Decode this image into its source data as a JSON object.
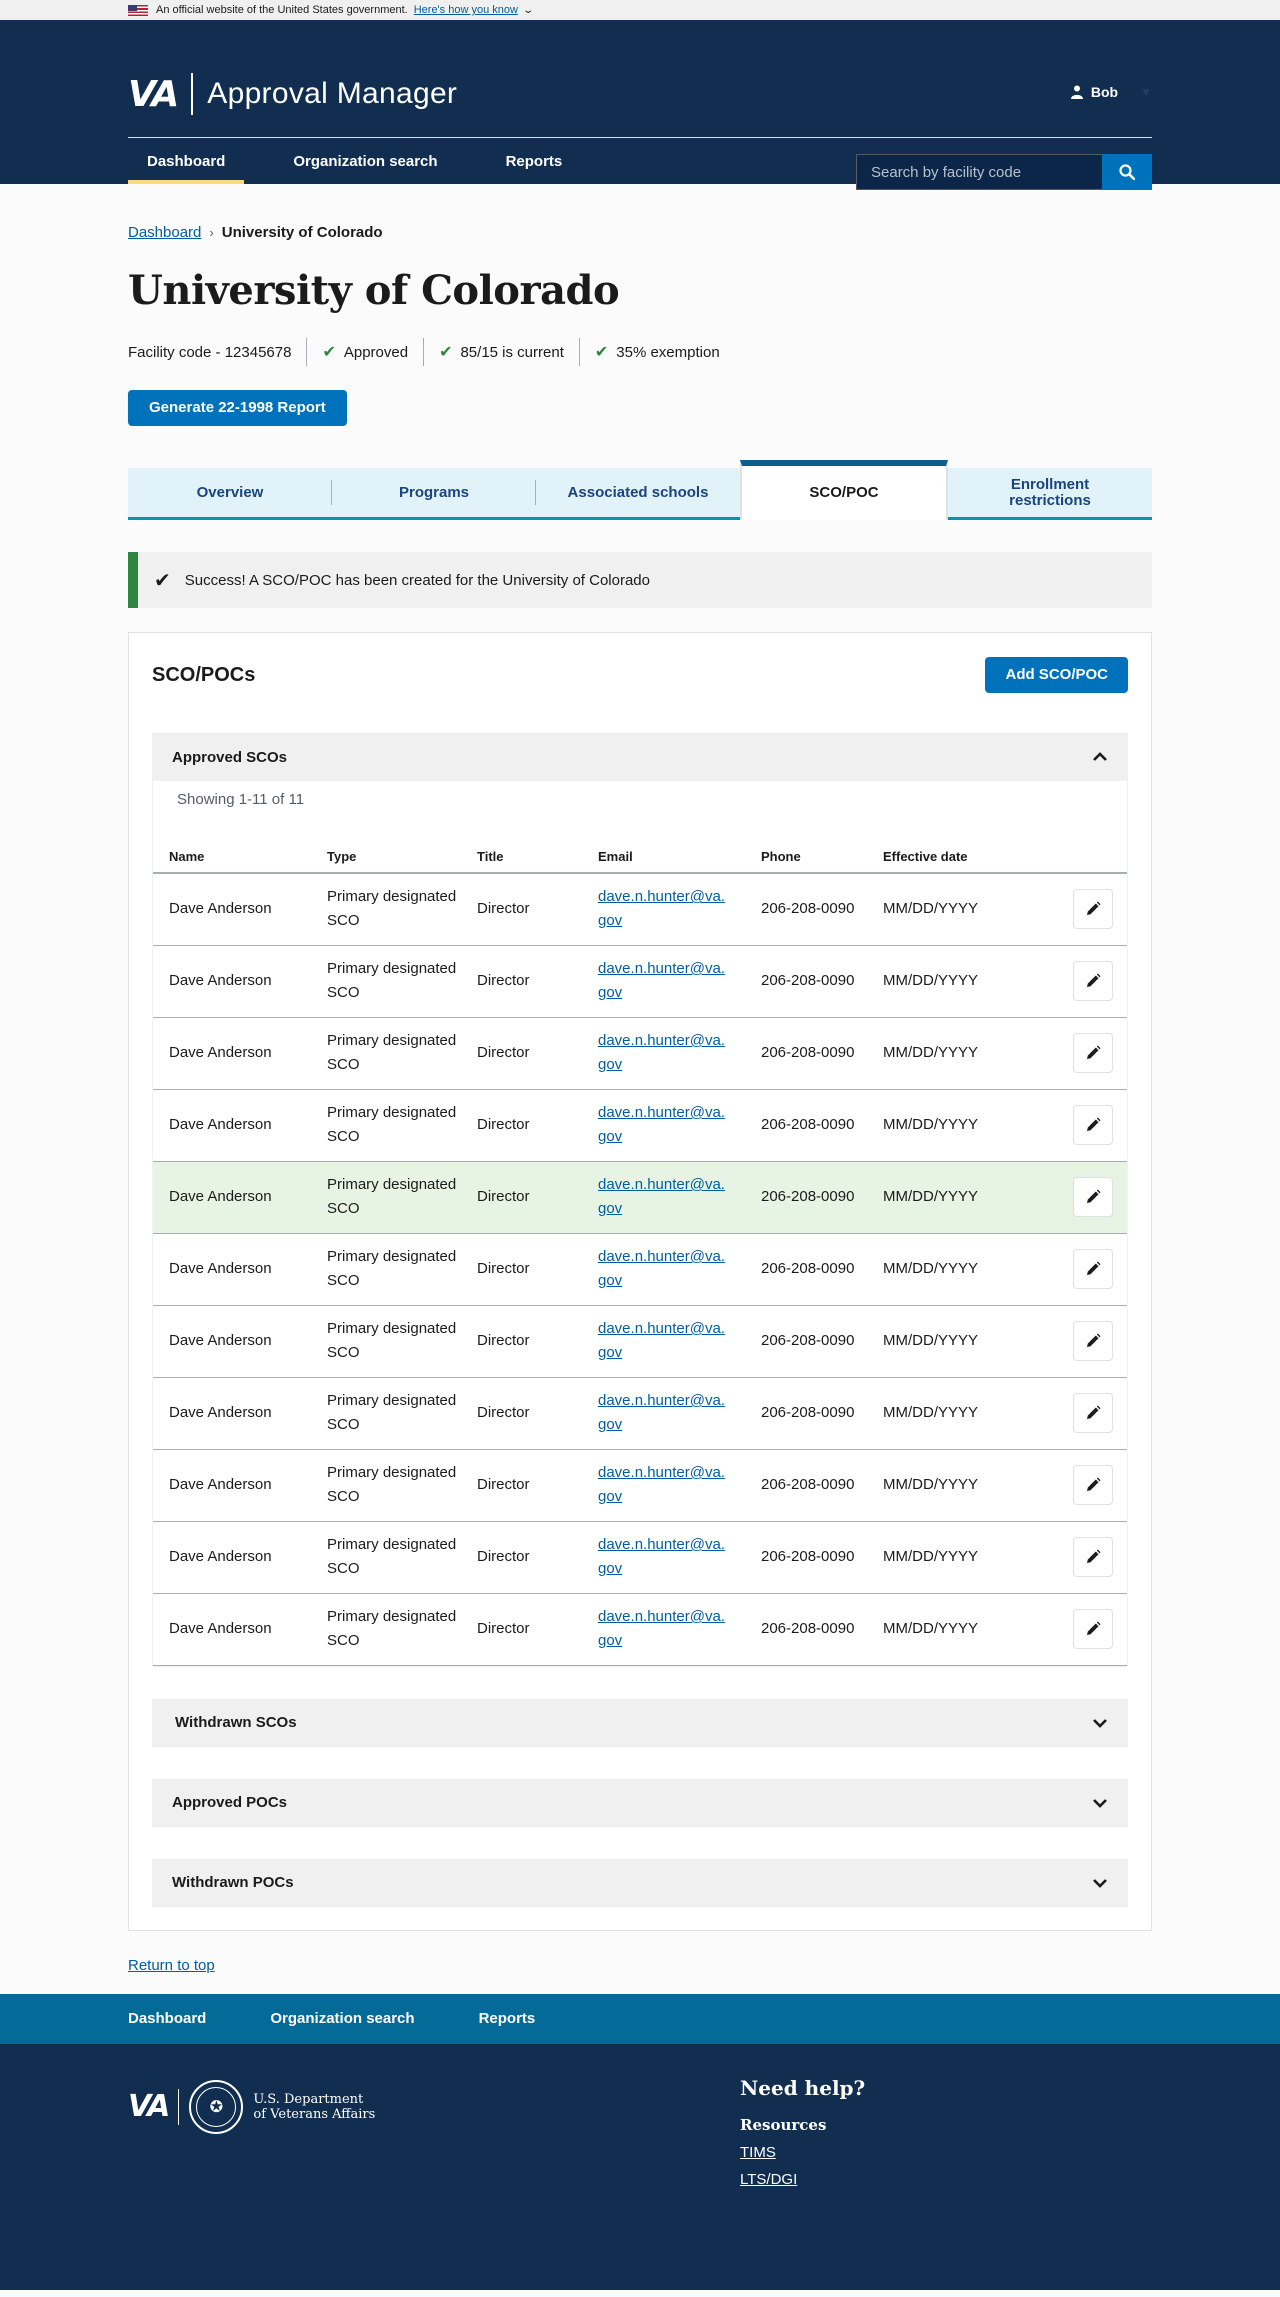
{
  "gov_banner": {
    "text": "An official website of the United States government.",
    "link": "Here's how you know"
  },
  "header": {
    "logo": "VA",
    "app_title": "Approval Manager",
    "user_name": "Bob",
    "nav": [
      "Dashboard",
      "Organization search",
      "Reports"
    ],
    "search_placeholder": "Search by facility code"
  },
  "breadcrumb": {
    "home": "Dashboard",
    "current": "University of Colorado"
  },
  "page": {
    "title": "University of Colorado",
    "facility_code": "Facility code - 12345678",
    "statuses": [
      "Approved",
      "85/15 is current",
      "35% exemption"
    ],
    "report_button": "Generate 22-1998 Report"
  },
  "tabs": [
    "Overview",
    "Programs",
    "Associated schools",
    "SCO/POC",
    "Enrollment restrictions"
  ],
  "alert": {
    "message": "Success! A SCO/POC has been created for the University of Colorado"
  },
  "panel": {
    "title": "SCO/POCs",
    "add_button": "Add SCO/POC",
    "approved_scos": {
      "title": "Approved SCOs",
      "showing": "Showing 1-11 of 11",
      "columns": [
        "Name",
        "Type",
        "Title",
        "Email",
        "Phone",
        "Effective date"
      ],
      "rows": [
        {
          "name": "Dave Anderson",
          "type": "Primary designated SCO",
          "title": "Director",
          "email": "dave.n.hunter@va.gov",
          "phone": "206-208-0090",
          "date": "MM/DD/YYYY"
        },
        {
          "name": "Dave Anderson",
          "type": "Primary designated SCO",
          "title": "Director",
          "email": "dave.n.hunter@va.gov",
          "phone": "206-208-0090",
          "date": "MM/DD/YYYY"
        },
        {
          "name": "Dave Anderson",
          "type": "Primary designated SCO",
          "title": "Director",
          "email": "dave.n.hunter@va.gov",
          "phone": "206-208-0090",
          "date": "MM/DD/YYYY"
        },
        {
          "name": "Dave Anderson",
          "type": "Primary designated SCO",
          "title": "Director",
          "email": "dave.n.hunter@va.gov",
          "phone": "206-208-0090",
          "date": "MM/DD/YYYY"
        },
        {
          "name": "Dave Anderson",
          "type": "Primary designated SCO",
          "title": "Director",
          "email": "dave.n.hunter@va.gov",
          "phone": "206-208-0090",
          "date": "MM/DD/YYYY",
          "highlight": true
        },
        {
          "name": "Dave Anderson",
          "type": "Primary designated SCO",
          "title": "Director",
          "email": "dave.n.hunter@va.gov",
          "phone": "206-208-0090",
          "date": "MM/DD/YYYY"
        },
        {
          "name": "Dave Anderson",
          "type": "Primary designated SCO",
          "title": "Director",
          "email": "dave.n.hunter@va.gov",
          "phone": "206-208-0090",
          "date": "MM/DD/YYYY"
        },
        {
          "name": "Dave Anderson",
          "type": "Primary designated SCO",
          "title": "Director",
          "email": "dave.n.hunter@va.gov",
          "phone": "206-208-0090",
          "date": "MM/DD/YYYY"
        },
        {
          "name": "Dave Anderson",
          "type": "Primary designated SCO",
          "title": "Director",
          "email": "dave.n.hunter@va.gov",
          "phone": "206-208-0090",
          "date": "MM/DD/YYYY"
        },
        {
          "name": "Dave Anderson",
          "type": "Primary designated SCO",
          "title": "Director",
          "email": "dave.n.hunter@va.gov",
          "phone": "206-208-0090",
          "date": "MM/DD/YYYY"
        },
        {
          "name": "Dave Anderson",
          "type": "Primary designated SCO",
          "title": "Director",
          "email": "dave.n.hunter@va.gov",
          "phone": "206-208-0090",
          "date": "MM/DD/YYYY"
        }
      ]
    },
    "collapsed_sections": [
      "Withdrawn SCOs",
      "Approved POCs",
      "Withdrawn POCs"
    ]
  },
  "return_to_top": "Return to top",
  "footer": {
    "nav": [
      "Dashboard",
      "Organization search",
      "Reports"
    ],
    "logo": "VA",
    "department": [
      "U.S. Department",
      "of Veterans Affairs"
    ],
    "help_title": "Need help?",
    "resources_title": "Resources",
    "links": [
      "TIMS",
      "LTS/DGI"
    ]
  },
  "colors": {
    "header_bg": "#112e51",
    "primary": "#0071bb",
    "success": "#2e8540",
    "footer_nav_bg": "#046b99"
  }
}
